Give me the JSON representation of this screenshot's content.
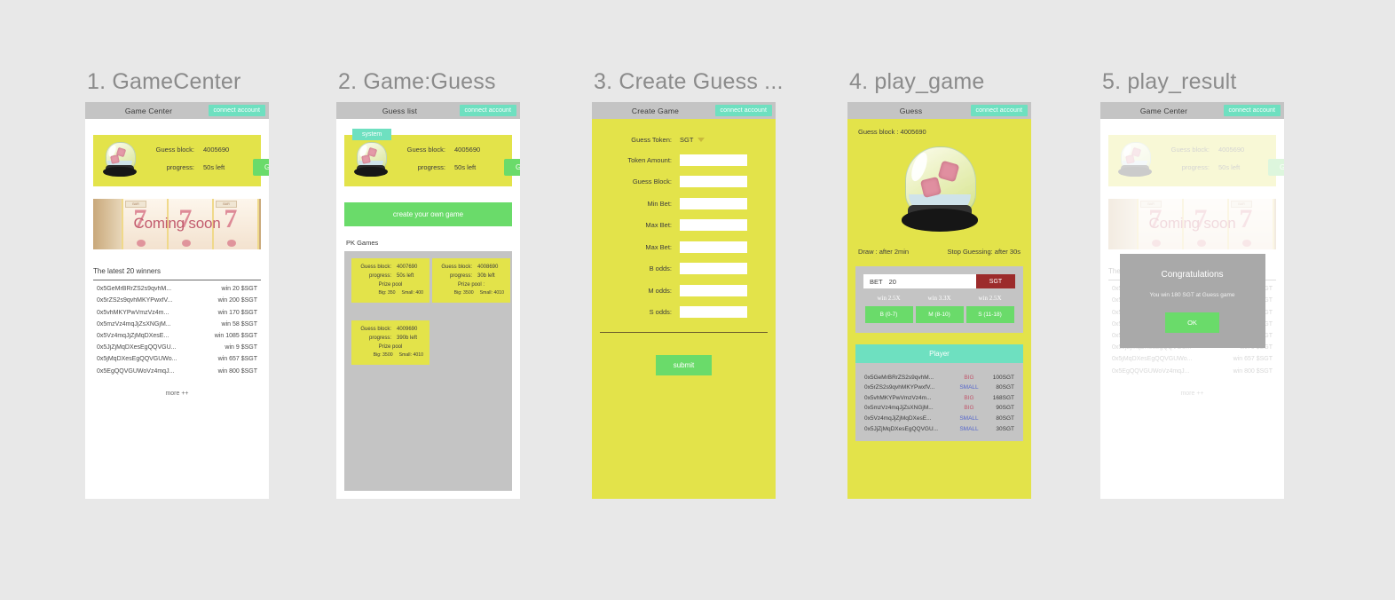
{
  "panels": [
    {
      "number_title": "1. GameCenter",
      "appbar": {
        "title": "Game Center",
        "connect": "connect account"
      },
      "hero": {
        "block_label": "Guess block:",
        "block_value": "4005690",
        "progress_label": "progress:",
        "progress_value": "50s left",
        "guess_button": "Guess"
      },
      "banner": {
        "text": "Coming soon",
        "bar": "BAR"
      },
      "winners": {
        "title": "The latest 20 winners",
        "more": "more ++",
        "rows": [
          {
            "addr": "0x5GeMrBRrZS2s9qvhM...",
            "prize": "win 20 $SGT"
          },
          {
            "addr": "0x5rZS2s9qvhMKYPwxfV...",
            "prize": "win 200 $SGT"
          },
          {
            "addr": "0x5vhMKYPwVmzVz4m...",
            "prize": "win 170 $SGT"
          },
          {
            "addr": "0x5mzVz4mqJjZsXNGjM...",
            "prize": "win 58 $SGT"
          },
          {
            "addr": "0x5Vz4mqJjZjMqDXesE...",
            "prize": "win 1085 $SGT"
          },
          {
            "addr": "0x5JjZjMqDXesEgQQVGU...",
            "prize": "win 9 $SGT"
          },
          {
            "addr": "0x5jMqDXesEgQQVGUWo...",
            "prize": "win 657 $SGT"
          },
          {
            "addr": "0x5EgQQVGUWoVz4mqJ...",
            "prize": "win 800 $SGT"
          }
        ]
      }
    },
    {
      "number_title": "2. Game:Guess",
      "appbar": {
        "title": "Guess list",
        "connect": "connect account"
      },
      "system_badge": "system",
      "hero": {
        "block_label": "Guess block:",
        "block_value": "4005690",
        "progress_label": "progress:",
        "progress_value": "50s left",
        "guess_button": "Guess"
      },
      "create_own": "create your own game",
      "pk_label": "PK Games",
      "pk_cards": [
        {
          "block_label": "Guess block:",
          "block": "4007690",
          "progress_label": "progress:",
          "progress": "50s left",
          "pool_label": "Prize pool",
          "big": "Big: 350",
          "small": "Small: 400"
        },
        {
          "block_label": "Guess block:",
          "block": "4008690",
          "progress_label": "progress:",
          "progress": "30b left",
          "pool_label": "Prize pool :",
          "big": "Big: 3500",
          "small": "Small: 4010"
        },
        {
          "block_label": "Guess block:",
          "block": "4009690",
          "progress_label": "progress:",
          "progress": "390b left",
          "pool_label": "Prize pool",
          "big": "Big: 3500",
          "small": "Small: 4010"
        }
      ]
    },
    {
      "number_title": "3. Create Guess ...",
      "appbar": {
        "title": "Create Game",
        "connect": "connect account"
      },
      "form": {
        "token_label": "Guess Token:",
        "token_value": "SGT",
        "fields": [
          {
            "label": "Token Amount:",
            "value": ""
          },
          {
            "label": "Guess Block:",
            "value": ""
          },
          {
            "label": "Min  Bet:",
            "value": ""
          },
          {
            "label": "Max Bet:",
            "value": ""
          },
          {
            "label": "Max Bet:",
            "value": ""
          },
          {
            "label": "B odds:",
            "value": ""
          },
          {
            "label": "M odds:",
            "value": ""
          },
          {
            "label": "S odds:",
            "value": ""
          }
        ],
        "submit": "submit"
      }
    },
    {
      "number_title": "4. play_game",
      "appbar": {
        "title": "Guess",
        "connect": "connect account"
      },
      "guess_block": "Guess block : 4005690",
      "draw": "Draw :  after 2min",
      "stop": "Stop Guessing:  after 30s",
      "bet": {
        "input_label": "BET",
        "input_value": "20",
        "token": "SGT",
        "options": [
          {
            "odds": "win 2.5X",
            "button": "B (0-7)"
          },
          {
            "odds": "win 3.3X",
            "button": "M  (8-10)"
          },
          {
            "odds": "win 2.5X",
            "button": "S (11-18)"
          }
        ]
      },
      "player_header": "Player",
      "players": [
        {
          "addr": "0x5GeMrBRrZS2s9qvhM...",
          "side": "BIG",
          "amount": "100SGT"
        },
        {
          "addr": "0x5rZS2s9qvhMKYPwxfV...",
          "side": "SMALL",
          "amount": "80SGT"
        },
        {
          "addr": "0x5vhMKYPwVmzVz4m...",
          "side": "BIG",
          "amount": "168SGT"
        },
        {
          "addr": "0x5mzVz4mqJjZsXNGjM...",
          "side": "BIG",
          "amount": "90SGT"
        },
        {
          "addr": "0x5Vz4mqJjZjMqDXesE...",
          "side": "SMALL",
          "amount": "80SGT"
        },
        {
          "addr": "0x5JjZjMqDXesEgQQVGU...",
          "side": "SMALL",
          "amount": "30SGT"
        }
      ]
    },
    {
      "number_title": "5. play_result",
      "appbar": {
        "title": "Game Center",
        "connect": "connect account"
      },
      "hero": {
        "block_label": "Guess block:",
        "block_value": "4005690",
        "progress_label": "progress:",
        "progress_value": "50s left",
        "guess_button": "Guess"
      },
      "banner": {
        "text": "Coming soon",
        "bar": "BAR"
      },
      "winners": {
        "title": "The latest 20 winners",
        "more": "more ++",
        "rows": [
          {
            "addr": "0x5GeMrBRrZS2s9qvhM...",
            "prize": "win 20 $SGT"
          },
          {
            "addr": "0x5rZS2s9qvhMKYPwxfV...",
            "prize": "win 200 $SGT"
          },
          {
            "addr": "0x5vhMKYPwVmzVz4m...",
            "prize": "win 170 $SGT"
          },
          {
            "addr": "0x5mzVz4mqJjZsXNGjM...",
            "prize": "win 58 $SGT"
          },
          {
            "addr": "0x5Vz4mqJjZjMqDXesE...",
            "prize": "win 1085 $SGT"
          },
          {
            "addr": "0x5JjZjMqDXesEgQQVGU...",
            "prize": "win 9 $SGT"
          },
          {
            "addr": "0x5jMqDXesEgQQVGUWo...",
            "prize": "win 657 $SGT"
          },
          {
            "addr": "0x5EgQQVGUWoVz4mqJ...",
            "prize": "win 800 $SGT"
          }
        ]
      },
      "modal": {
        "title": "Congratulations",
        "message": "You win 180 SGT at Guess game",
        "ok": "OK"
      }
    }
  ],
  "colors": {
    "page_bg": "#e8e8e8",
    "appbar": "#c4c4c4",
    "teal": "#6ee0c0",
    "yellow": "#e3e34a",
    "green": "#6adb6a",
    "dark_red": "#9c2b2b",
    "big": "#c0566c",
    "small": "#5566cc"
  }
}
